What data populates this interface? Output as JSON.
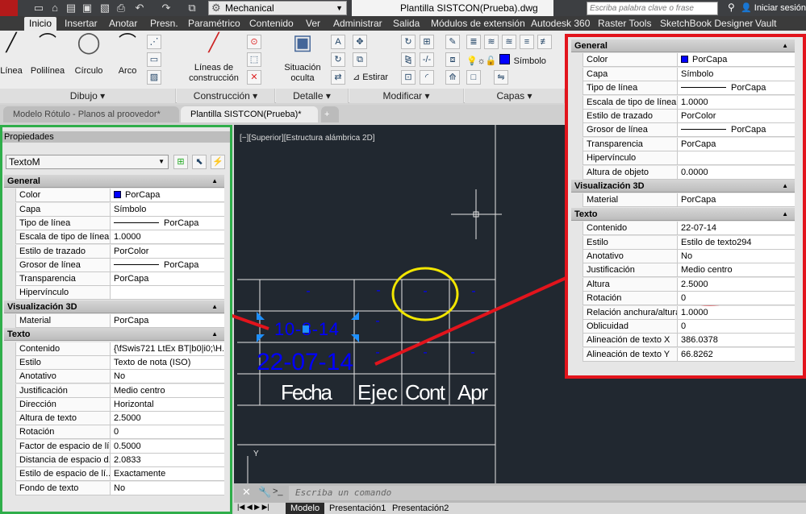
{
  "titlebar": {
    "app_letter": "M",
    "workspace": "Mechanical",
    "document_title": "Plantilla SISTCON(Prueba).dwg",
    "search_placeholder": "Escriba palabra clave o frase",
    "signin": "Iniciar sesión"
  },
  "ribbon_tabs": [
    "Inicio",
    "Insertar",
    "Anotar",
    "Presn.",
    "Paramétrico",
    "Contenido",
    "Ver",
    "Administrar",
    "Salida",
    "Módulos de extensión",
    "Autodesk 360",
    "Raster Tools",
    "SketchBook Designer",
    "Vault"
  ],
  "active_tab": "Inicio",
  "ribbon": {
    "dibujo": {
      "title": "Dibujo",
      "buttons": [
        "Línea",
        "Polilínea",
        "Círculo",
        "Arco"
      ]
    },
    "construccion": {
      "title": "Construcción",
      "button": "Líneas de construcción"
    },
    "detalle": {
      "title": "Detalle",
      "button": "Situación oculta"
    },
    "modificar": {
      "title": "Modificar",
      "estirar": "Estirar"
    },
    "capas": {
      "title": "Capas",
      "layer": "Símbolo",
      "layer_color": "#0000ff"
    }
  },
  "doc_tabs": [
    {
      "label": "Modelo Rótulo - Planos al proovedor*",
      "active": false
    },
    {
      "label": "Plantilla SISTCON(Prueba)*",
      "active": true
    }
  ],
  "viewport_label": "[−][Superior][Estructura alámbrica 2D]",
  "drawing": {
    "texts": {
      "date_selected": "10-8-14",
      "date_other": "22-07-14",
      "headers": [
        "Fecha",
        "Ejec",
        "Cont",
        "Apr"
      ],
      "dash": "-"
    }
  },
  "annotation_colors": {
    "left_panel": "#2fae4a",
    "right_panel": "#e2141c",
    "highlight_circle": "#f2e600",
    "text_blue": "#0000ff"
  },
  "left_panel": {
    "title": "Propiedades",
    "selector": "TextoM",
    "sections": [
      {
        "title": "General",
        "rows": [
          [
            "Color",
            "PorCapa",
            "swatch"
          ],
          [
            "Capa",
            "Símbolo"
          ],
          [
            "Tipo de línea",
            "PorCapa",
            "line"
          ],
          [
            "Escala de tipo de línea",
            "1.0000"
          ],
          [
            "Estilo de trazado",
            "PorColor"
          ],
          [
            "Grosor de línea",
            "PorCapa",
            "line"
          ],
          [
            "Transparencia",
            "PorCapa"
          ],
          [
            "Hipervínculo",
            ""
          ]
        ]
      },
      {
        "title": "Visualización 3D",
        "rows": [
          [
            "Material",
            "PorCapa"
          ]
        ]
      },
      {
        "title": "Texto",
        "rows": [
          [
            "Contenido",
            "{\\fSwis721 LtEx BT|b0|i0;\\H..."
          ],
          [
            "Estilo",
            "Texto de nota (ISO)"
          ],
          [
            "Anotativo",
            "No"
          ],
          [
            "Justificación",
            "Medio centro"
          ],
          [
            "Dirección",
            "Horizontal"
          ],
          [
            "Altura de texto",
            "2.5000"
          ],
          [
            "Rotación",
            "0"
          ],
          [
            "Factor de espacio de lí...",
            "0.5000"
          ],
          [
            "Distancia de espacio d...",
            "2.0833"
          ],
          [
            "Estilo de espacio de lí...",
            "Exactamente"
          ],
          [
            "Fondo de texto",
            "No"
          ]
        ]
      }
    ]
  },
  "right_panel": {
    "sections": [
      {
        "title": "General",
        "rows": [
          [
            "Color",
            "PorCapa",
            "swatch"
          ],
          [
            "Capa",
            "Símbolo"
          ],
          [
            "Tipo de línea",
            "PorCapa",
            "line"
          ],
          [
            "Escala de tipo de línea",
            "1.0000"
          ],
          [
            "Estilo de trazado",
            "PorColor"
          ],
          [
            "Grosor de línea",
            "PorCapa",
            "line"
          ],
          [
            "Transparencia",
            "PorCapa"
          ],
          [
            "Hipervínculo",
            ""
          ],
          [
            "Altura de objeto",
            "0.0000"
          ]
        ]
      },
      {
        "title": "Visualización 3D",
        "rows": [
          [
            "Material",
            "PorCapa"
          ]
        ]
      },
      {
        "title": "Texto",
        "rows": [
          [
            "Contenido",
            "22-07-14"
          ],
          [
            "Estilo",
            "Estilo de texto294"
          ],
          [
            "Anotativo",
            "No"
          ],
          [
            "Justificación",
            "Medio centro"
          ],
          [
            "Altura",
            "2.5000"
          ],
          [
            "Rotación",
            "0"
          ],
          [
            "Relación anchura/altura",
            "1.0000"
          ],
          [
            "Oblicuidad",
            "0"
          ],
          [
            "Alineación de texto X",
            "386.0378"
          ],
          [
            "Alineación de texto Y",
            "66.8262"
          ]
        ]
      }
    ]
  },
  "command": {
    "placeholder": "Escriba un comando"
  },
  "layout_tabs": [
    "Modelo",
    "Presentación1",
    "Presentación2"
  ]
}
